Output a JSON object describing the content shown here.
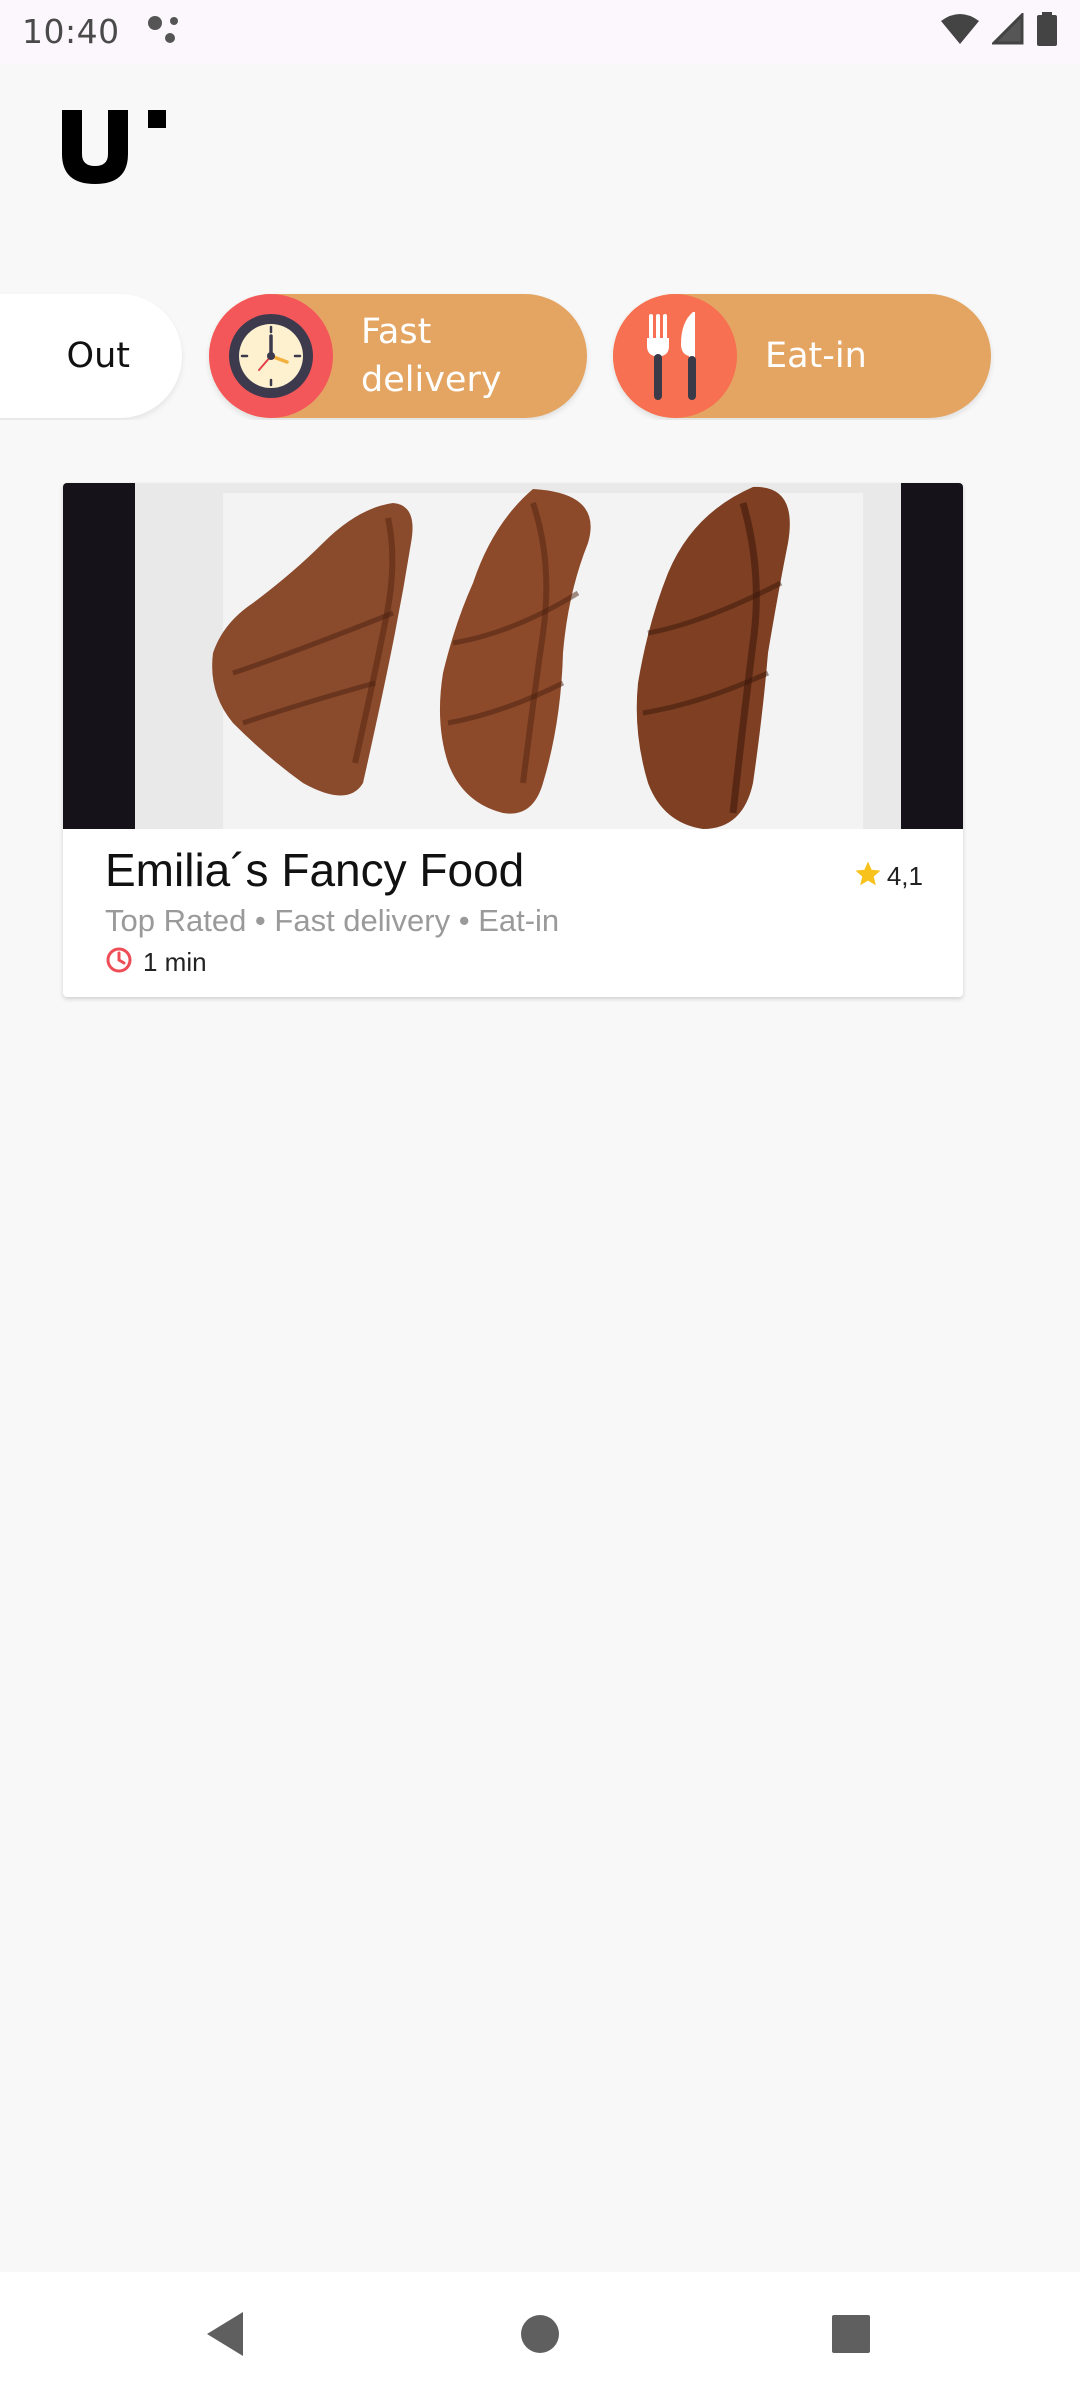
{
  "status_bar": {
    "time": "10:40",
    "icons": [
      "assistant-dots-icon",
      "wifi-icon",
      "cell-signal-icon",
      "battery-icon"
    ]
  },
  "logo": {
    "icon": "brand-logo-icon",
    "color": "#000000"
  },
  "categories": [
    {
      "label": "Out",
      "icon": "",
      "selected": false
    },
    {
      "label": "Fast\ndelivery",
      "icon": "clock-icon",
      "selected": false
    },
    {
      "label": "Eat-in",
      "icon": "fork-knife-icon",
      "selected": false
    }
  ],
  "restaurant": {
    "name": "Emilia´s Fancy Food",
    "tags": "Top Rated • Fast delivery • Eat-in",
    "delivery_time": "1 min",
    "rating": "4,1",
    "image_icon": "grilled-steaks-photo"
  },
  "colors": {
    "chip_orange": "#e4a563",
    "clock_circle": "#f4575a",
    "cutlery_circle": "#f77052",
    "star": "#f7c21b",
    "time_icon": "#ef4d55",
    "background": "#f8f8f8"
  },
  "nav_bar": {
    "icons": [
      "back-icon",
      "home-icon",
      "recents-icon"
    ]
  }
}
